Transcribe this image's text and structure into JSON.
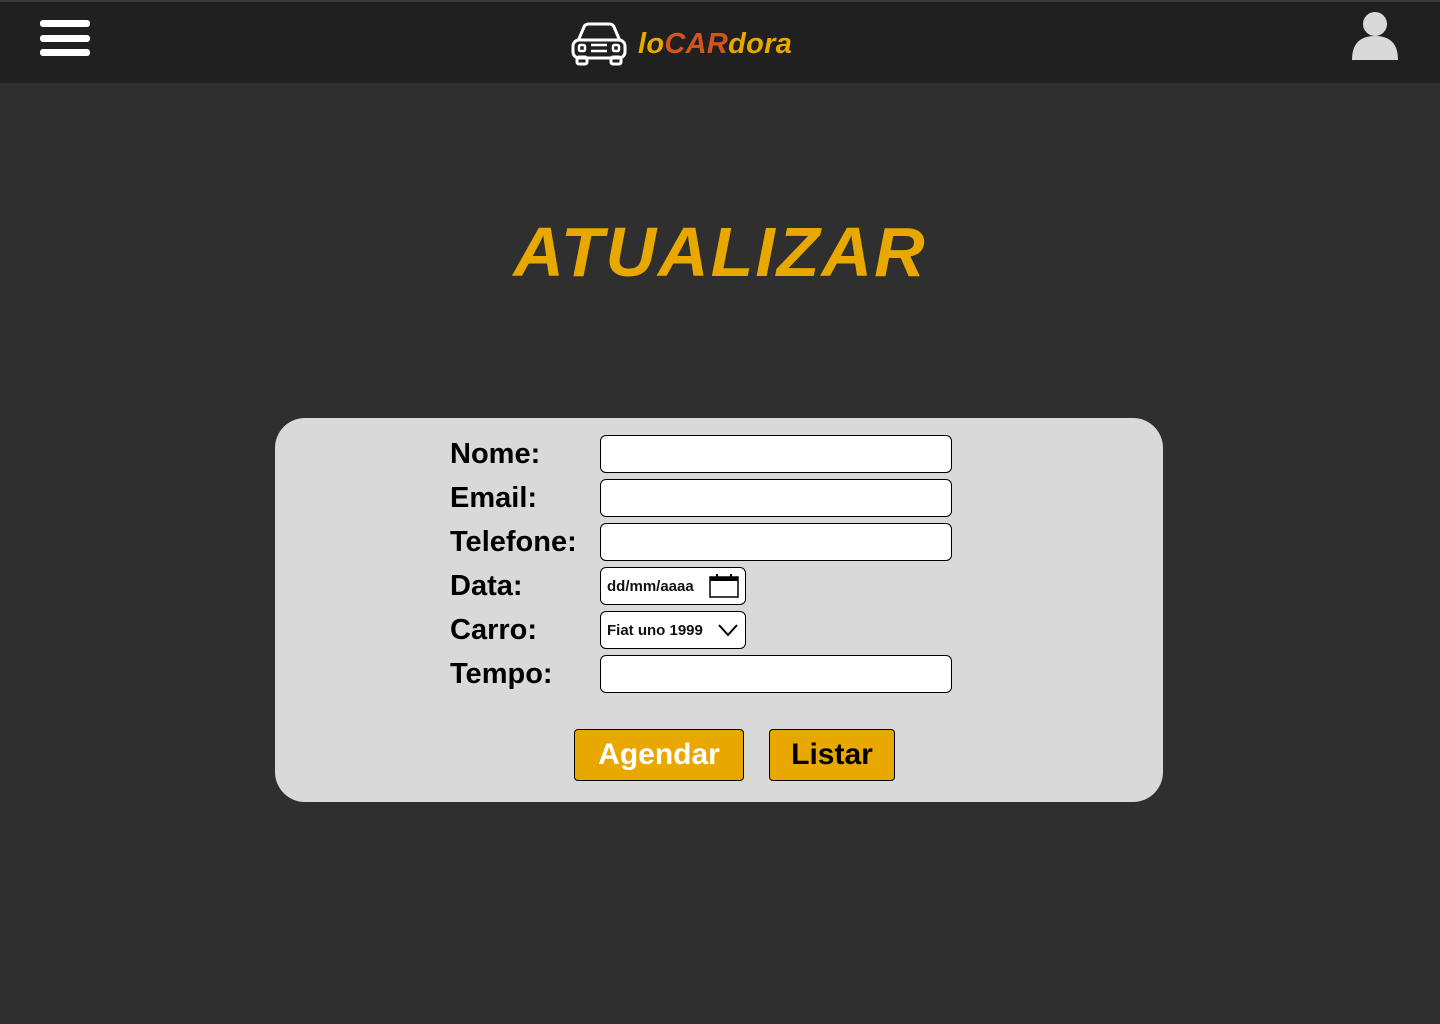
{
  "header": {
    "brand_part1": "lo",
    "brand_part2": "CAR",
    "brand_part3": "dora",
    "menu_icon": "hamburger-menu-icon",
    "logo_icon": "car-icon",
    "user_icon": "user-avatar-icon"
  },
  "page": {
    "title": "ATUALIZAR"
  },
  "form": {
    "nome_label": "Nome:",
    "nome_value": "",
    "email_label": "Email:",
    "email_value": "",
    "telefone_label": "Telefone:",
    "telefone_value": "",
    "data_label": "Data:",
    "data_placeholder": "dd/mm/aaaa",
    "carro_label": "Carro:",
    "carro_selected": "Fiat uno 1999",
    "tempo_label": "Tempo:",
    "tempo_value": "",
    "agendar_label": "Agendar",
    "listar_label": "Listar"
  },
  "colors": {
    "accent": "#e8a800",
    "brand_mid": "#d2541e",
    "header_bg": "#202020",
    "page_bg": "#2f2f2f",
    "card_bg": "#d9d9d9"
  }
}
